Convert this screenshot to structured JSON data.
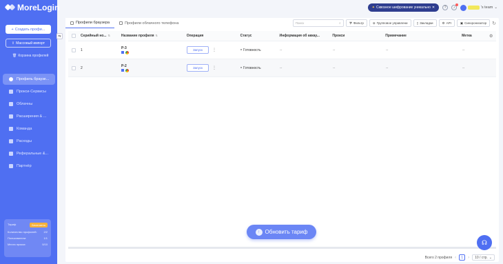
{
  "app": {
    "name": "MoreLogin"
  },
  "sidebar": {
    "create_label": "Создать профи...",
    "mass_import_label": "Массовый импорт",
    "trash_label": "Корзина профилей",
    "items": [
      {
        "label": "Профиль браузе...",
        "icon": "browser-icon"
      },
      {
        "label": "Прокси-Сервисы",
        "icon": "proxy-icon"
      },
      {
        "label": "Облачны",
        "icon": "cloud-icon"
      },
      {
        "label": "Расширения & ...",
        "icon": "extension-icon"
      },
      {
        "label": "Команда",
        "icon": "team-icon"
      },
      {
        "label": "Расходы",
        "icon": "billing-icon"
      },
      {
        "label": "Реферальные &...",
        "icon": "referral-icon"
      },
      {
        "label": "Партнёр",
        "icon": "partner-icon"
      }
    ],
    "plan": {
      "name_label": "Тариф",
      "plan_badge": "Бесплатно",
      "rows": [
        {
          "label": "Количество профилей:",
          "value": "2/2"
        },
        {
          "label": "Пользователи:",
          "value": "1/1"
        },
        {
          "label": "Места прокси:",
          "value": "0/10"
        }
      ]
    }
  },
  "topbar": {
    "promo_text": "Сквозное шифрование уникально",
    "user_name": "'s team"
  },
  "tabs": [
    {
      "label": "Профили браузера"
    },
    {
      "label": "Профили облачного телефона"
    }
  ],
  "toolbar": {
    "search_placeholder": "Поиск",
    "filter": "Фильтр",
    "group_management": "Групповое управлени",
    "bookmarks": "Закладки",
    "api": "API",
    "synchronizer": "Синхронизатор"
  },
  "table": {
    "columns": [
      "Серийный но...",
      "Название профиля",
      "Операция",
      "Статус",
      "Информация об аккау...",
      "Прокси",
      "Примечание",
      "Метка"
    ],
    "launch_label": "Запуск",
    "rows": [
      {
        "num": "1",
        "name": "P-3",
        "status": "Готовность",
        "info": "--",
        "proxy": "--",
        "note": "--",
        "tag": "--"
      },
      {
        "num": "2",
        "name": "P-2",
        "status": "Готовность",
        "info": "--",
        "proxy": "--",
        "note": "--",
        "tag": "--"
      }
    ]
  },
  "pager": {
    "total": "Всего 2 профиля",
    "current": "1",
    "page_size": "10 / стр."
  },
  "upgrade_label": "Обновить тариф"
}
